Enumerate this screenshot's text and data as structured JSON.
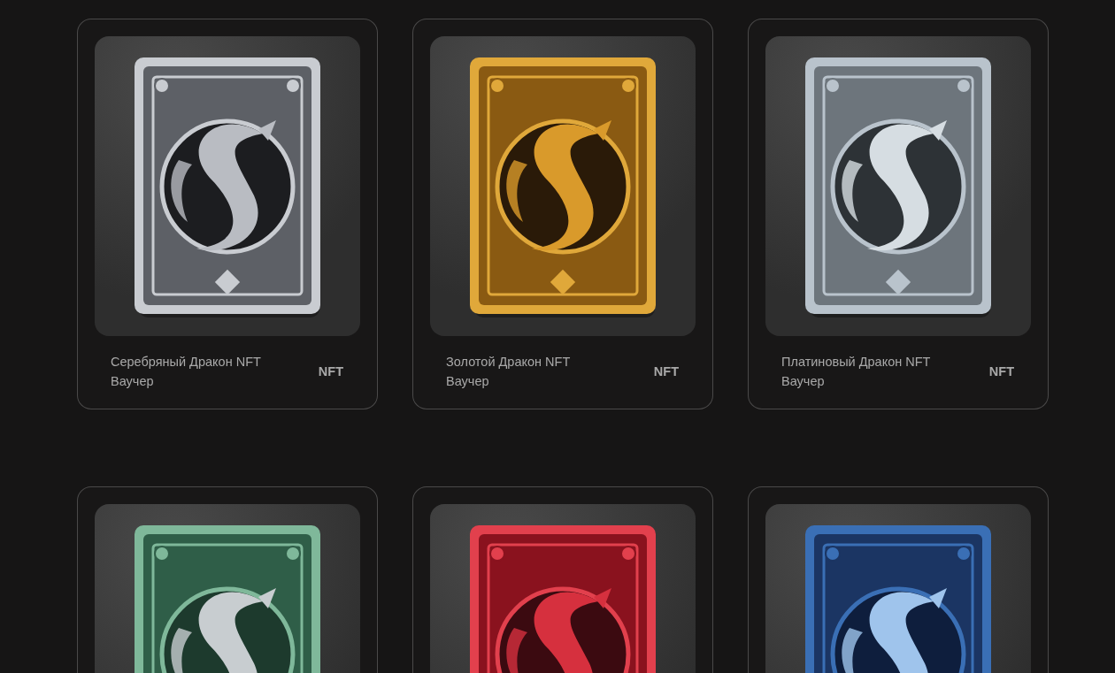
{
  "cards": [
    {
      "kind": "picture",
      "title": "Серебряный Дракон NFT Ваучер",
      "badge": "NFT"
    },
    {
      "kind": "picture",
      "title": "Золотой Дракон NFT Ваучер",
      "badge": "NFT"
    },
    {
      "kind": "picture",
      "title": "Платиновый Дракон NFT Ваучер",
      "badge": "NFT"
    },
    {
      "kind": "picture"
    },
    {
      "kind": "picture"
    },
    {
      "kind": "picture"
    }
  ]
}
